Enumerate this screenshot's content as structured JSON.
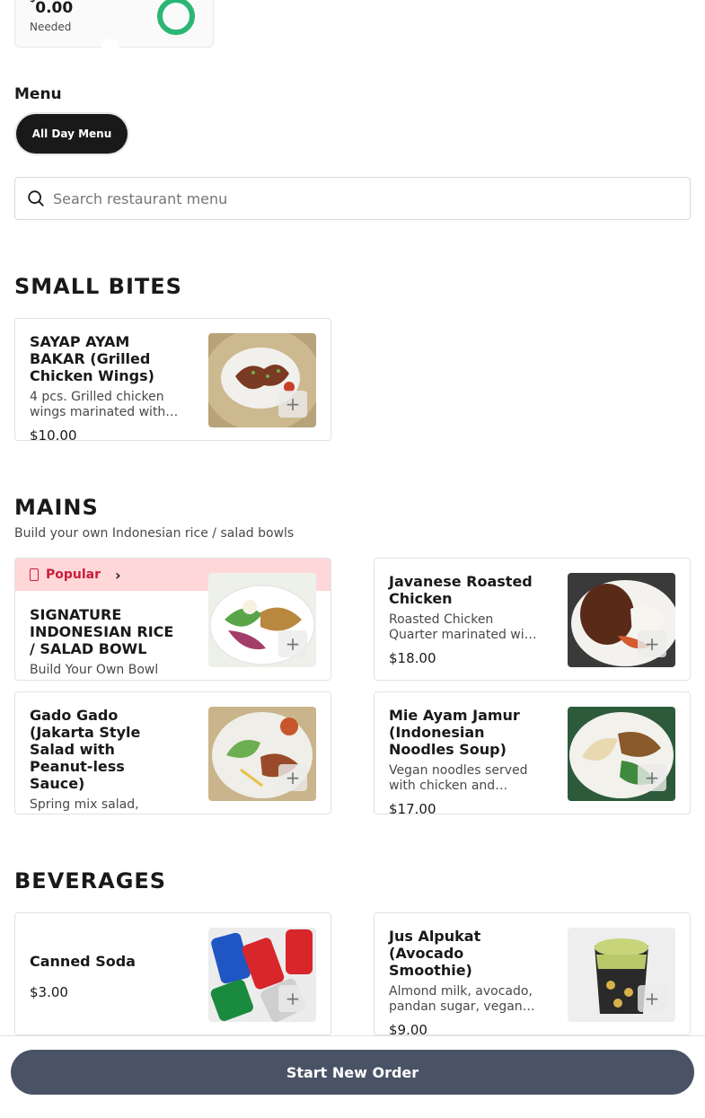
{
  "budget": {
    "currency": "$",
    "amount": "0.00",
    "label": "Needed"
  },
  "menu": {
    "heading": "Menu",
    "tabs": [
      {
        "label": "All Day Menu"
      }
    ]
  },
  "search": {
    "placeholder": "Search restaurant menu"
  },
  "sections": [
    {
      "title": "SMALL BITES",
      "subtitle": "",
      "items": [
        {
          "name": "SAYAP AYAM BAKAR (Grilled Chicken Wings)",
          "description": "4 pcs. Grilled chicken wings marinated with…",
          "price": "$10.00",
          "image": "grilled-chicken-wings-photo"
        }
      ]
    },
    {
      "title": "MAINS",
      "subtitle": "Build your own Indonesian rice / salad bowls",
      "items": [
        {
          "badge": "Popular",
          "name": "SIGNATURE INDONESIAN RICE / SALAD BOWL",
          "description": "Build Your Own Bowl",
          "price": "",
          "image": "rice-salad-bowl-photo"
        },
        {
          "name": "Javanese Roasted Chicken",
          "description": "Roasted Chicken Quarter marinated wi…",
          "price": "$18.00",
          "image": "roasted-chicken-photo"
        },
        {
          "name": "Gado Gado (Jakarta Style Salad with Peanut-less Sauce)",
          "description": "Spring mix salad,",
          "price": "",
          "image": "gado-gado-photo"
        },
        {
          "name": "Mie Ayam Jamur (Indonesian Noodles Soup)",
          "description": "Vegan noodles served with chicken and…",
          "price": "$17.00",
          "image": "noodle-soup-photo"
        }
      ]
    },
    {
      "title": "BEVERAGES",
      "subtitle": "",
      "items": [
        {
          "name": "Canned Soda",
          "description": "",
          "price": "$3.00",
          "image": "canned-soda-photo"
        },
        {
          "name": "Jus Alpukat (Avocado Smoothie)",
          "description": "Almond milk, avocado, pandan sugar, vegan…",
          "price": "$9.00",
          "image": "avocado-smoothie-photo"
        }
      ]
    }
  ],
  "footer": {
    "button_label": "Start New Order"
  },
  "colors": {
    "accent_green": "#2bb673",
    "popular_bg": "#ffd7d9",
    "popular_text": "#c81e3a",
    "button_bg": "#4a5365"
  },
  "icons": {
    "search": "search-icon",
    "add": "plus-icon",
    "popular": "badge-icon",
    "chevron": "chevron-right-icon"
  }
}
